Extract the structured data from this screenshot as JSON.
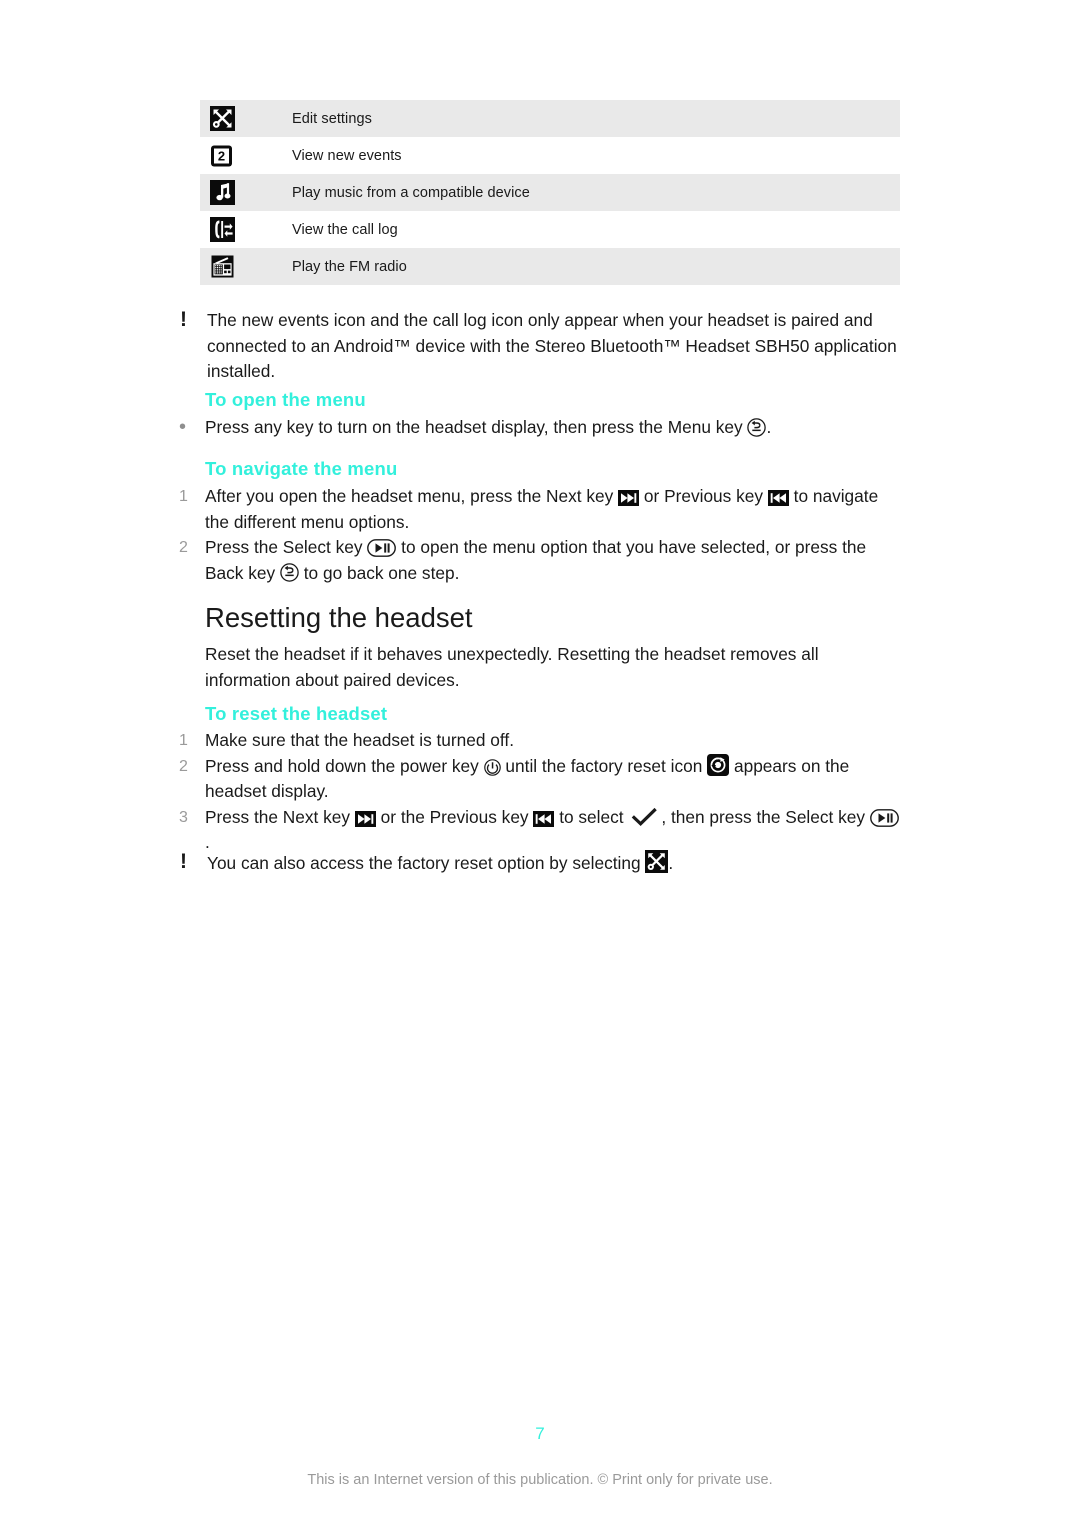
{
  "page": {
    "number": "7",
    "footer_note": "This is an Internet version of this publication. © Print only for private use."
  },
  "icon_table": {
    "rows": [
      {
        "icon": "tools-icon",
        "label": "Edit settings"
      },
      {
        "icon": "new-events-icon",
        "label": "View new events"
      },
      {
        "icon": "music-note-icon",
        "label": "Play music from a compatible device"
      },
      {
        "icon": "call-log-icon",
        "label": "View the call log"
      },
      {
        "icon": "fm-radio-icon",
        "label": "Play the FM radio"
      }
    ]
  },
  "note_pairing": {
    "marker": "!",
    "text": "The new events icon and the call log icon only appear when your headset is paired and connected to an Android™ device with the Stereo Bluetooth™ Headset SBH50 application installed."
  },
  "open_menu": {
    "heading": "To open the menu",
    "bullet": "•",
    "text_before": "Press any key to turn on the headset display, then press the Menu key",
    "text_after": "."
  },
  "navigate_menu": {
    "heading": "To navigate the menu",
    "steps": [
      {
        "number": "1",
        "part1": "After you open the headset menu, press the Next key",
        "part2": "or Previous key",
        "part3": "to navigate the different menu options."
      },
      {
        "number": "2",
        "part1": "Press the Select key",
        "part2": "to open the menu option that you have selected, or press the Back key",
        "part3": "to go back one step."
      }
    ]
  },
  "resetting": {
    "heading": "Resetting the headset",
    "paragraph": "Reset the headset if it behaves unexpectedly. Resetting the headset removes all information about paired devices.",
    "sub_heading": "To reset the headset",
    "steps": [
      {
        "number": "1",
        "part1": "Make sure that the headset is turned off.",
        "part2": "",
        "part3": ""
      },
      {
        "number": "2",
        "part1": "Press and hold down the power key",
        "part2": "until the factory reset icon",
        "part3": "appears on the headset display."
      },
      {
        "number": "3",
        "part1": "Press the Next key",
        "part2": "or the Previous key",
        "part3": "to select",
        "part4": ", then press the Select key",
        "part5": "."
      }
    ],
    "note": {
      "marker": "!",
      "text_before": "You can also access the factory reset option by selecting",
      "text_after": "."
    }
  },
  "colors": {
    "accent": "#33f0dc",
    "row_shade": "#e9e9e9",
    "text": "#1a1a1a",
    "muted": "#9a9a9a"
  }
}
